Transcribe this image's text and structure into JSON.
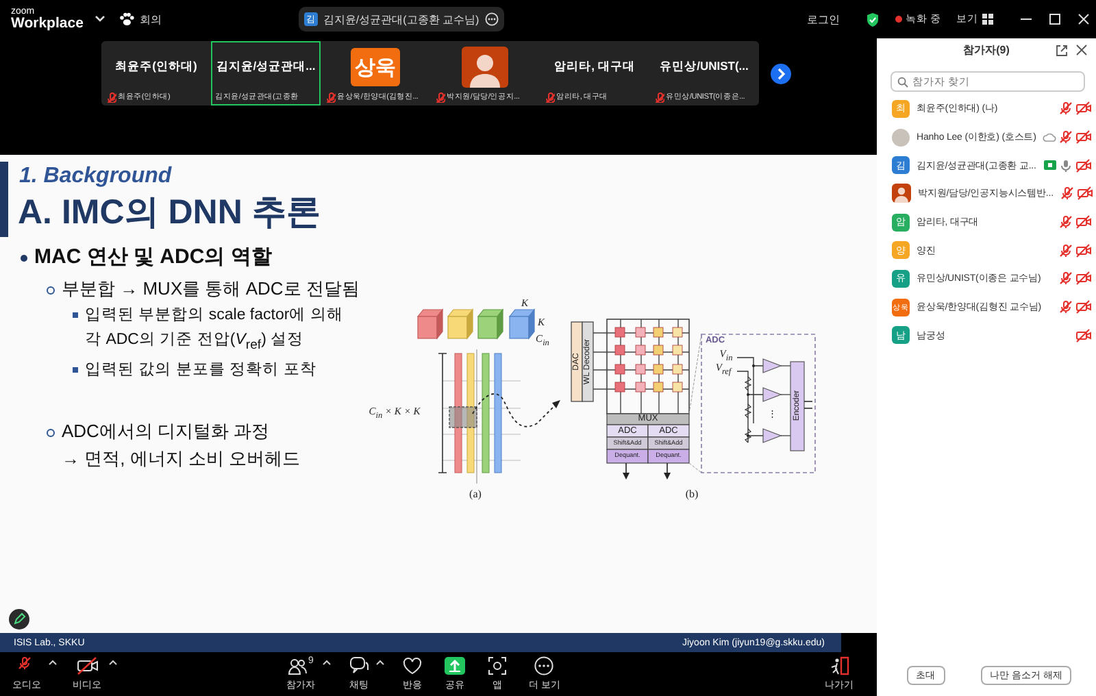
{
  "app": {
    "brand_small": "zoom",
    "brand": "Workplace",
    "menu_label": "회의"
  },
  "speaker_pill": {
    "avatar": "김",
    "name": "김지윤/성균관대(고종환 교수님)"
  },
  "top_right": {
    "login": "로그인",
    "recording": "녹화 중",
    "view": "보기"
  },
  "video_tiles": [
    {
      "kind": "name",
      "title": "최윤주(인하대)",
      "caption": "최윤주(인하대)",
      "muted": true,
      "selected": false
    },
    {
      "kind": "name",
      "title": "김지윤/성균관대...",
      "caption": "김지윤/성균관대(고종환",
      "muted": false,
      "selected": true
    },
    {
      "kind": "initials",
      "title": "상욱",
      "color": "#f26d0f",
      "caption": "윤상욱/한양대(김형진...",
      "muted": true,
      "selected": false
    },
    {
      "kind": "silhouette",
      "color": "#c2410c",
      "caption": "박지원/담당/인공지...",
      "muted": true,
      "selected": false
    },
    {
      "kind": "name",
      "title": "암리타, 대구대",
      "caption": "암리타, 대구대",
      "muted": true,
      "selected": false
    },
    {
      "kind": "name",
      "title": "유민상/UNIST(...",
      "caption": "유민상/UNIST(이종은...",
      "muted": true,
      "selected": false
    }
  ],
  "slide": {
    "section": "1. Background",
    "title": "A. IMC의 DNN 추론",
    "bullets": [
      {
        "text": "MAC 연산 및 ADC의 역할",
        "children": [
          {
            "text": "부분합 → MUX를 통해 ADC로 전달됨",
            "children": [
              {
                "text": "입력된 부분합의 scale factor에 의해\n각 ADC의 기준 전압(*V*$_{ref}$) 설정"
              },
              {
                "text": "입력된 값의 분포를 정확히 포착"
              }
            ]
          },
          {
            "text": "ADC에서의 디지털화 과정\n→ 면적, 에너지 소비 오버헤드"
          }
        ]
      }
    ],
    "figure": {
      "part_a": {
        "dim_width": "K",
        "dim_height": "K",
        "dim_depth": "C$_{in}$",
        "matrix_label": "C$_{in}$ × K × K",
        "caption": "(a)"
      },
      "part_b": {
        "dac": "DAC",
        "decoder": "WL Decoder",
        "mux": "MUX",
        "columns": [
          {
            "adc": "ADC",
            "shift_add": "Shift&Add",
            "dequant": "Dequant."
          },
          {
            "adc": "ADC",
            "shift_add": "Shift&Add",
            "dequant": "Dequant."
          }
        ],
        "adc_title": "ADC",
        "v_in": "V$_{in}$",
        "v_ref": "V$_{ref}$",
        "dots": "⋮",
        "encoder": "Encoder",
        "caption": "(b)"
      }
    },
    "footer": {
      "left": "ISIS Lab., SKKU",
      "right": "Jiyoon Kim (jiyun19@g.skku.edu)"
    }
  },
  "toolbar": [
    {
      "kind": "audio",
      "label": "오디오",
      "caret": true
    },
    {
      "kind": "video",
      "label": "비디오",
      "caret": true
    },
    {
      "kind": "participants",
      "label": "참가자",
      "count": "9",
      "caret": true
    },
    {
      "kind": "chat",
      "label": "채팅",
      "caret": true
    },
    {
      "kind": "reactions",
      "label": "반응",
      "caret": false
    },
    {
      "kind": "share",
      "label": "공유",
      "caret": false
    },
    {
      "kind": "apps",
      "label": "앱",
      "caret": false
    },
    {
      "kind": "more",
      "label": "더 보기",
      "caret": false
    },
    {
      "kind": "leave",
      "label": "나가기",
      "caret": false
    }
  ],
  "panel": {
    "title": "참가자(9)",
    "search": {
      "placeholder": "참가자 찾기"
    },
    "participants": [
      {
        "name": "최윤주(인하대) (나)",
        "avatar": {
          "kind": "initials",
          "text": "최",
          "color": "#f5a623"
        },
        "cloud": false,
        "sharing": false,
        "audio": true,
        "muted": true,
        "video_off": true
      },
      {
        "name": "Hanho Lee (이한호) (호스트)",
        "avatar": {
          "kind": "photo"
        },
        "cloud": true,
        "sharing": false,
        "audio": true,
        "muted": true,
        "video_off": true
      },
      {
        "name": "김지윤/성균관대(고종환 교...",
        "avatar": {
          "kind": "initials",
          "text": "김",
          "color": "#2d7dd2"
        },
        "cloud": false,
        "sharing": true,
        "audio": true,
        "muted": false,
        "video_off": true
      },
      {
        "name": "박지원/담당/인공지능시스템반...",
        "avatar": {
          "kind": "silhouette",
          "color": "#c2410c"
        },
        "cloud": false,
        "sharing": false,
        "audio": true,
        "muted": true,
        "video_off": true
      },
      {
        "name": "암리타, 대구대",
        "avatar": {
          "kind": "initials",
          "text": "암",
          "color": "#27ae60"
        },
        "cloud": false,
        "sharing": false,
        "audio": true,
        "muted": true,
        "video_off": true
      },
      {
        "name": "양진",
        "avatar": {
          "kind": "initials",
          "text": "양",
          "color": "#f5a623"
        },
        "cloud": false,
        "sharing": false,
        "audio": true,
        "muted": true,
        "video_off": true
      },
      {
        "name": "유민상/UNIST(이종은 교수님)",
        "avatar": {
          "kind": "initials",
          "text": "유",
          "color": "#16a085"
        },
        "cloud": false,
        "sharing": false,
        "audio": true,
        "muted": true,
        "video_off": true
      },
      {
        "name": "윤상욱/한양대(김형진 교수님)",
        "avatar": {
          "kind": "initials",
          "text": "상욱",
          "color": "#f26d0f"
        },
        "cloud": false,
        "sharing": false,
        "audio": true,
        "muted": true,
        "video_off": true
      },
      {
        "name": "남궁성",
        "avatar": {
          "kind": "initials",
          "text": "남",
          "color": "#16a085"
        },
        "cloud": false,
        "sharing": false,
        "audio": false,
        "video_off": true
      }
    ],
    "buttons": [
      "초대",
      "나만 음소거 해제"
    ]
  }
}
